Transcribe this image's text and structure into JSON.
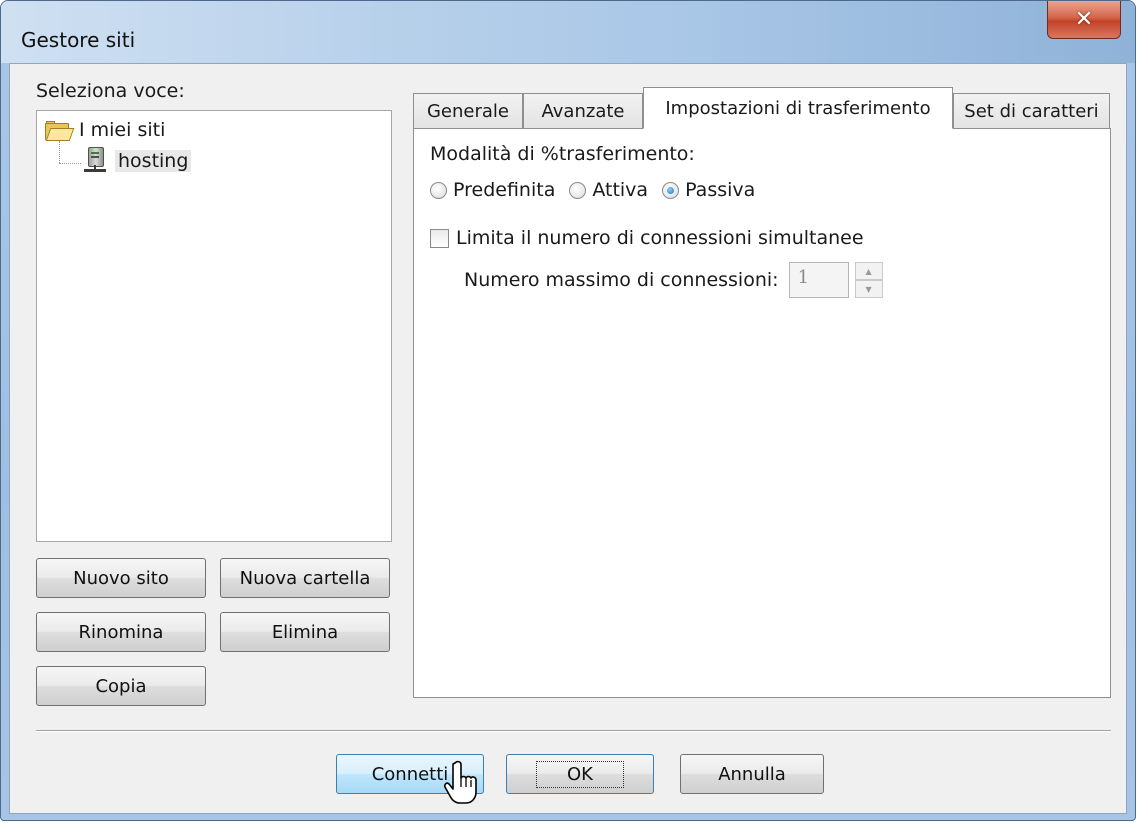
{
  "window": {
    "title": "Gestore siti"
  },
  "sidebar": {
    "select_label": "Seleziona voce:",
    "tree": {
      "root": "I miei siti",
      "child": "hosting"
    },
    "buttons": {
      "new_site": "Nuovo sito",
      "new_folder": "Nuova cartella",
      "rename": "Rinomina",
      "delete": "Elimina",
      "copy": "Copia"
    }
  },
  "tabs": [
    {
      "label": "Generale"
    },
    {
      "label": "Avanzate"
    },
    {
      "label": "Impostazioni di trasferimento",
      "active": true
    },
    {
      "label": "Set di caratteri"
    }
  ],
  "transfer": {
    "mode_label": "Modalità di %trasferimento:",
    "modes": [
      "Predefinita",
      "Attiva",
      "Passiva"
    ],
    "selected_mode": "Passiva",
    "limit_label": "Limita il numero di connessioni simultanee",
    "limit_checked": false,
    "max_label": "Numero massimo di connessioni:",
    "max_value": "1"
  },
  "footer": {
    "connect": "Connetti",
    "ok": "OK",
    "cancel": "Annulla"
  },
  "icons": [
    "close-icon",
    "folder-icon",
    "server-icon",
    "hand-cursor-icon"
  ]
}
